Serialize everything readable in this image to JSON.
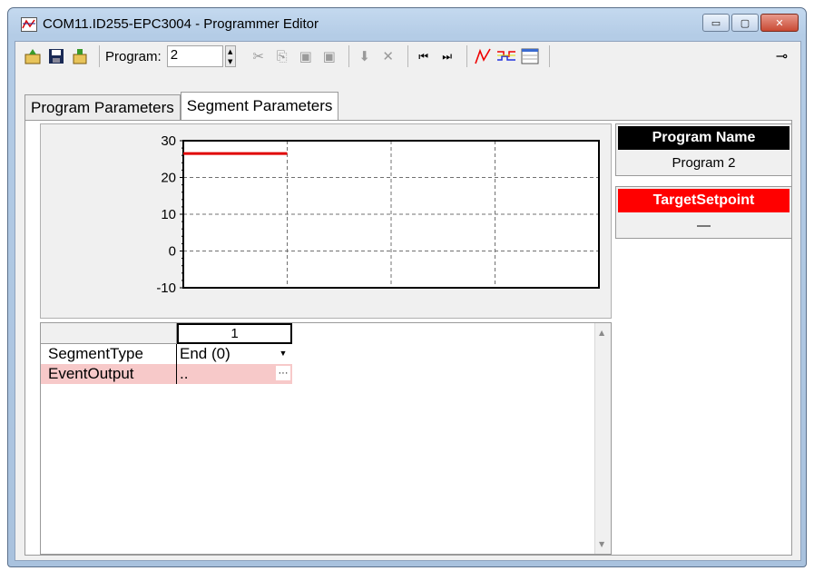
{
  "window": {
    "title": "COM11.ID255-EPC3004 - Programmer Editor",
    "minimize_glyph": "▭",
    "maximize_glyph": "▢",
    "close_glyph": "✕"
  },
  "toolbar": {
    "program_label": "Program:",
    "program_value": "2",
    "icons": [
      "open-icon",
      "save-icon",
      "download-icon",
      "cut-icon",
      "copy-icon",
      "paste-icon",
      "paste-special-icon",
      "insert-icon",
      "delete-icon",
      "first-icon",
      "last-icon",
      "chart-icon",
      "events-icon",
      "table-icon",
      "pin-icon"
    ]
  },
  "tabs": [
    {
      "label": "Program Parameters",
      "active": false
    },
    {
      "label": "Segment Parameters",
      "active": true
    }
  ],
  "chart_data": {
    "type": "line",
    "title": "",
    "xlabel": "",
    "ylabel": "",
    "ylim": [
      -10,
      30
    ],
    "yticks": [
      "30",
      "20",
      "10",
      "0",
      "-10"
    ],
    "grid": true,
    "series": [
      {
        "color": "#e00000",
        "x": [
          0,
          1
        ],
        "values": [
          26.5,
          26.5
        ]
      }
    ],
    "xlim": [
      0,
      4
    ]
  },
  "params": {
    "program_name_header": "Program Name",
    "program_name_value": "Program 2",
    "target_setpoint_header": "TargetSetpoint",
    "target_setpoint_value": "—"
  },
  "grid": {
    "column_header": "1",
    "rows": [
      {
        "label": "SegmentType",
        "value": "End (0)",
        "control": "dropdown"
      },
      {
        "label": "EventOutput",
        "value": "..",
        "control": "ellipsis"
      }
    ]
  },
  "colors": {
    "header_black": "#000000",
    "header_red": "#ff0000",
    "row_pink": "#f7c9c9",
    "series_red": "#e00000"
  }
}
